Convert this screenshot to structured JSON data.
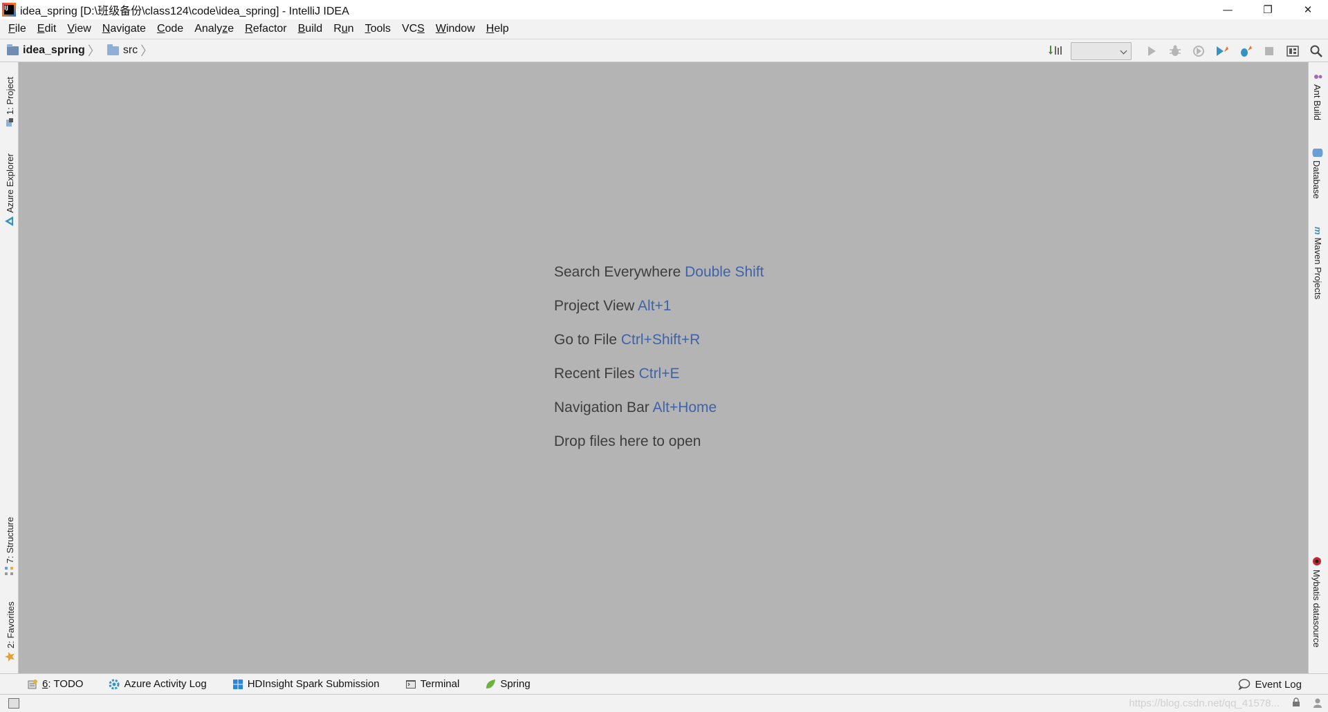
{
  "window": {
    "title": "idea_spring [D:\\班级备份\\class124\\code\\idea_spring] - IntelliJ IDEA",
    "controls": {
      "minimize": "—",
      "restore": "❐",
      "close": "✕"
    }
  },
  "menu": [
    {
      "pre": "",
      "mn": "F",
      "post": "ile"
    },
    {
      "pre": "",
      "mn": "E",
      "post": "dit"
    },
    {
      "pre": "",
      "mn": "V",
      "post": "iew"
    },
    {
      "pre": "",
      "mn": "N",
      "post": "avigate"
    },
    {
      "pre": "",
      "mn": "C",
      "post": "ode"
    },
    {
      "pre": "Analy",
      "mn": "z",
      "post": "e"
    },
    {
      "pre": "",
      "mn": "R",
      "post": "efactor"
    },
    {
      "pre": "",
      "mn": "B",
      "post": "uild"
    },
    {
      "pre": "R",
      "mn": "u",
      "post": "n"
    },
    {
      "pre": "",
      "mn": "T",
      "post": "ools"
    },
    {
      "pre": "VC",
      "mn": "S",
      "post": ""
    },
    {
      "pre": "",
      "mn": "W",
      "post": "indow"
    },
    {
      "pre": "",
      "mn": "H",
      "post": "elp"
    }
  ],
  "breadcrumb": {
    "project": "idea_spring",
    "folder": "src"
  },
  "left_tabs": {
    "project": "1: Project",
    "azure": "Azure Explorer",
    "structure": "7: Structure",
    "favorites": "2: Favorites"
  },
  "right_tabs": {
    "ant": "Ant Build",
    "database": "Database",
    "maven": "Maven Projects",
    "mybatis": "Mybatis datasource"
  },
  "hints": [
    {
      "label": "Search Everywhere",
      "shortcut": "Double Shift"
    },
    {
      "label": "Project View",
      "shortcut": "Alt+1"
    },
    {
      "label": "Go to File",
      "shortcut": "Ctrl+Shift+R"
    },
    {
      "label": "Recent Files",
      "shortcut": "Ctrl+E"
    },
    {
      "label": "Navigation Bar",
      "shortcut": "Alt+Home"
    },
    {
      "label": "Drop files here to open",
      "shortcut": ""
    }
  ],
  "bottom_tabs": {
    "todo_mn": "6",
    "todo_rest": ": TODO",
    "azure_log": "Azure Activity Log",
    "hdinsight": "HDInsight Spark Submission",
    "terminal": "Terminal",
    "spring": "Spring",
    "event_log": "Event Log"
  },
  "status": {
    "watermark": "https://blog.csdn.net/qq_41578..."
  },
  "colors": {
    "editor_bg": "#b4b4b4",
    "shortcut": "#3e63a8",
    "run_green": "#499c54",
    "debug_blue": "#3592c4"
  }
}
